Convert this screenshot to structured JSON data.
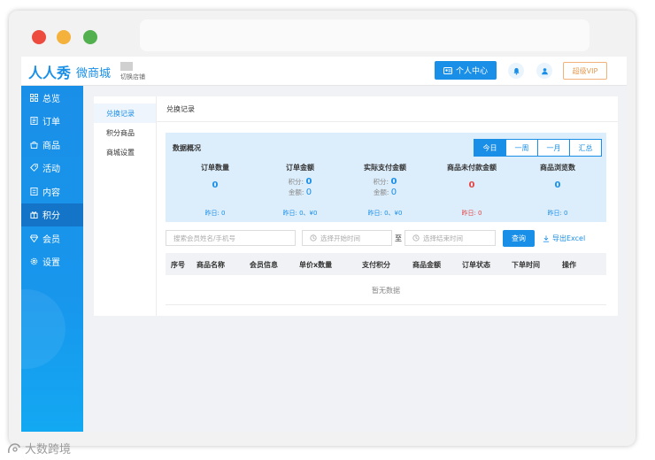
{
  "browser": {
    "colors": {
      "close": "#ee4b3f",
      "minimize": "#f4b13c",
      "maximize": "#53b04f"
    }
  },
  "header": {
    "logo_main": "人人秀",
    "logo_sub": "微商城",
    "store_switch": "切换店铺",
    "personal_center": "个人中心",
    "vip": "超级VIP",
    "accent": "#1a8fe8"
  },
  "sidebar": {
    "items": [
      {
        "label": "总览",
        "icon": "grid-icon"
      },
      {
        "label": "订单",
        "icon": "document-icon"
      },
      {
        "label": "商品",
        "icon": "bag-icon"
      },
      {
        "label": "活动",
        "icon": "tag-icon"
      },
      {
        "label": "内容",
        "icon": "list-icon"
      },
      {
        "label": "积分",
        "icon": "gift-icon"
      },
      {
        "label": "会员",
        "icon": "diamond-icon"
      },
      {
        "label": "设置",
        "icon": "gear-icon"
      }
    ]
  },
  "subnav": {
    "items": [
      {
        "label": "兑换记录"
      },
      {
        "label": "积分商品"
      },
      {
        "label": "商城设置"
      }
    ]
  },
  "panel": {
    "title": "兑换记录",
    "overview_title": "数据概况",
    "tabs": [
      "今日",
      "一周",
      "一月",
      "汇总"
    ],
    "stats": {
      "order_count": {
        "title": "订单数量",
        "value": "0",
        "yesterday": "昨日: 0"
      },
      "order_amount": {
        "title": "订单金额",
        "points_label": "积分:",
        "points_value": "0",
        "amount_label": "金额:",
        "amount_value": "0",
        "yesterday": "昨日: 0、¥0"
      },
      "paid_amount": {
        "title": "实际支付金额",
        "points_label": "积分:",
        "points_value": "0",
        "amount_label": "金额:",
        "amount_value": "0",
        "yesterday": "昨日: 0、¥0"
      },
      "unpaid_amount": {
        "title": "商品未付款金额",
        "value": "0",
        "yesterday": "昨日: 0"
      },
      "views": {
        "title": "商品浏览数",
        "value": "0",
        "yesterday": "昨日: 0"
      }
    }
  },
  "search": {
    "member_placeholder": "搜索会员姓名/手机号",
    "start_placeholder": "选择开始时间",
    "to_label": "至",
    "end_placeholder": "选择结束时间",
    "query_label": "查询",
    "export_label": "导出Excel"
  },
  "table": {
    "columns": [
      "序号",
      "商品名称",
      "会员信息",
      "单价x数量",
      "支付积分",
      "商品金额",
      "订单状态",
      "下单时间",
      "操作"
    ],
    "empty_text": "暂无数据"
  },
  "watermark": {
    "text": "大数跨境"
  }
}
